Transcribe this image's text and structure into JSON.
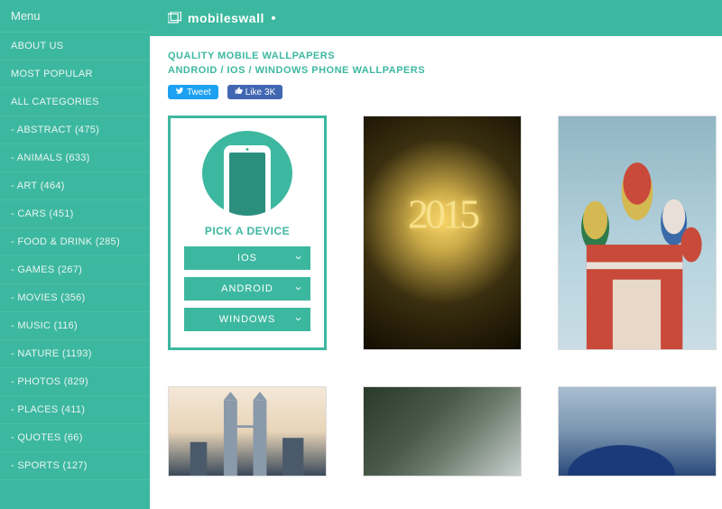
{
  "brand": {
    "name": "mobileswall"
  },
  "sidebar": {
    "menu_label": "Menu",
    "items": [
      {
        "label": "ABOUT US"
      },
      {
        "label": "MOST POPULAR"
      },
      {
        "label": "ALL CATEGORIES"
      },
      {
        "label": "- ABSTRACT (475)"
      },
      {
        "label": "- ANIMALS (633)"
      },
      {
        "label": "- ART (464)"
      },
      {
        "label": "- CARS (451)"
      },
      {
        "label": "- FOOD & DRINK (285)"
      },
      {
        "label": "- GAMES (267)"
      },
      {
        "label": "- MOVIES (356)"
      },
      {
        "label": "- MUSIC (116)"
      },
      {
        "label": "- NATURE (1193)"
      },
      {
        "label": "- PHOTOS (829)"
      },
      {
        "label": "- PLACES (411)"
      },
      {
        "label": "- QUOTES (66)"
      },
      {
        "label": "- SPORTS (127)"
      }
    ]
  },
  "headings": {
    "line1": "QUALITY MOBILE WALLPAPERS",
    "line2": "ANDROID / IOS / WINDOWS PHONE WALLPAPERS"
  },
  "social": {
    "tweet": "Tweet",
    "fb_like": "Like",
    "fb_count": "3K"
  },
  "device_picker": {
    "title": "PICK A DEVICE",
    "buttons": [
      {
        "label": "IOS"
      },
      {
        "label": "ANDROID"
      },
      {
        "label": "WINDOWS"
      }
    ]
  },
  "thumbs": {
    "fireworks_text": "2015"
  }
}
